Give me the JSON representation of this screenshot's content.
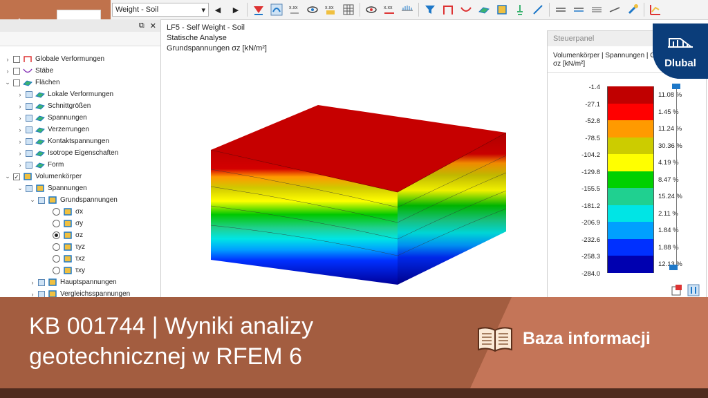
{
  "toolbar": {
    "load_case": "Weight - Soil"
  },
  "navigator": {
    "items": [
      {
        "label": "Globale Verformungen"
      },
      {
        "label": "Stäbe"
      },
      {
        "label": "Flächen"
      },
      {
        "label": "Lokale Verformungen"
      },
      {
        "label": "Schnittgrößen"
      },
      {
        "label": "Spannungen"
      },
      {
        "label": "Verzerrungen"
      },
      {
        "label": "Kontaktspannungen"
      },
      {
        "label": "Isotrope Eigenschaften"
      },
      {
        "label": "Form"
      },
      {
        "label": "Volumenkörper"
      },
      {
        "label": "Spannungen"
      },
      {
        "label": "Grundspannungen"
      },
      {
        "label": "σx"
      },
      {
        "label": "σy"
      },
      {
        "label": "σz"
      },
      {
        "label": "τyz"
      },
      {
        "label": "τxz"
      },
      {
        "label": "τxy"
      },
      {
        "label": "Hauptspannungen"
      },
      {
        "label": "Vergleichsspannungen"
      }
    ]
  },
  "view": {
    "line1": "LF5 - Self Weight - Soil",
    "line2": "Statische Analyse",
    "line3": "Grundspannungen σz [kN/m²]"
  },
  "panel": {
    "title": "Steuerpanel",
    "subtitle1": "Volumenkörper | Spannungen | Gr",
    "subtitle2": "σz [kN/m²]",
    "values": [
      "-1.4",
      "-27.1",
      "-52.8",
      "-78.5",
      "-104.2",
      "-129.8",
      "-155.5",
      "-181.2",
      "-206.9",
      "-232.6",
      "-258.3",
      "-284.0"
    ],
    "colors": [
      "#c00000",
      "#ff0000",
      "#ff9a00",
      "#cccc00",
      "#ffff00",
      "#00d000",
      "#20d090",
      "#00e5e5",
      "#00a0ff",
      "#0030ff",
      "#0000b0"
    ],
    "percents": [
      "11.08 %",
      "1.45 %",
      "11.24 %",
      "30.36 %",
      "4.19 %",
      "8.47 %",
      "15.24 %",
      "2.11 %",
      "1.84 %",
      "1.88 %",
      "12.13 %"
    ]
  },
  "logo": {
    "text": "Dlubal"
  },
  "banner": {
    "title": "KB 001744 | Wyniki analizy geotechnicznej w RFEM 6",
    "link": "Baza informacji"
  }
}
